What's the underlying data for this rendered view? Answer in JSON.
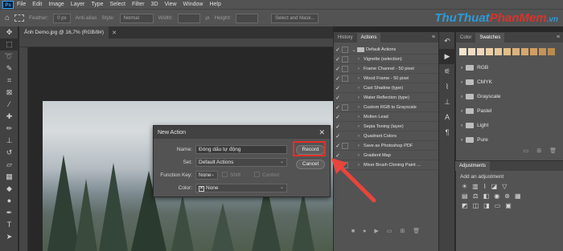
{
  "menubar": {
    "app_icon": "Ps",
    "items": [
      "File",
      "Edit",
      "Image",
      "Layer",
      "Type",
      "Select",
      "Filter",
      "3D",
      "View",
      "Window",
      "Help"
    ]
  },
  "options_bar": {
    "feather_label": "Feather:",
    "feather_value": "0 px",
    "antialias_label": "Anti-alias",
    "style_label": "Style:",
    "style_value": "Normal",
    "width_label": "Width:",
    "height_label": "Height:",
    "select_mask_label": "Select and Mask..."
  },
  "watermark": {
    "part1": "ThuThuat",
    "part2": "PhanMem",
    "part3": ".vn"
  },
  "document": {
    "tab_title": "Ảnh Demo.jpg @ 16,7% (RGB/8#)"
  },
  "actions_panel": {
    "tabs": [
      "History",
      "Actions"
    ],
    "active_tab": "Actions",
    "folder": "Default Actions",
    "items": [
      "Vignette (selection)",
      "Frame Channel - 50 pixel",
      "Wood Frame - 50 pixel",
      "Cast Shadow (type)",
      "Water Reflection (type)",
      "Custom RGB to Grayscale",
      "Molten Lead",
      "Sepia Toning (layer)",
      "Quadrant Colors",
      "Save as Photoshop PDF",
      "Gradient Map",
      "Mixer Brush Cloning Paint ..."
    ]
  },
  "swatches_panel": {
    "tabs": [
      "Color",
      "Swatches"
    ],
    "active_tab": "Swatches",
    "groups": [
      "RGB",
      "CMYK",
      "Grayscale",
      "Pastel",
      "Light",
      "Pure"
    ],
    "swatch_colors": [
      "#f3e4cf",
      "#f2dcc4",
      "#eed6b9",
      "#e9cfa9",
      "#e5c79b",
      "#e3be89",
      "#dcb37b",
      "#d6a86d",
      "#cf9f62",
      "#c49358",
      "#b98a51"
    ]
  },
  "adjustments_panel": {
    "tab": "Adjustments",
    "hint": "Add an adjustment"
  },
  "dialog": {
    "title": "New Action",
    "name_label": "Name:",
    "name_value": "Đóng dấu tự động",
    "set_label": "Set:",
    "set_value": "Default Actions",
    "function_key_label": "Function Key:",
    "function_key_value": "None",
    "shift_label": "Shift",
    "control_label": "Control",
    "color_label": "Color:",
    "color_value": "None",
    "record_button": "Record",
    "cancel_button": "Cancel"
  },
  "colors": {
    "highlight": "#e3312b",
    "arrow": "#e8453c",
    "accent": "#31a8ff"
  }
}
